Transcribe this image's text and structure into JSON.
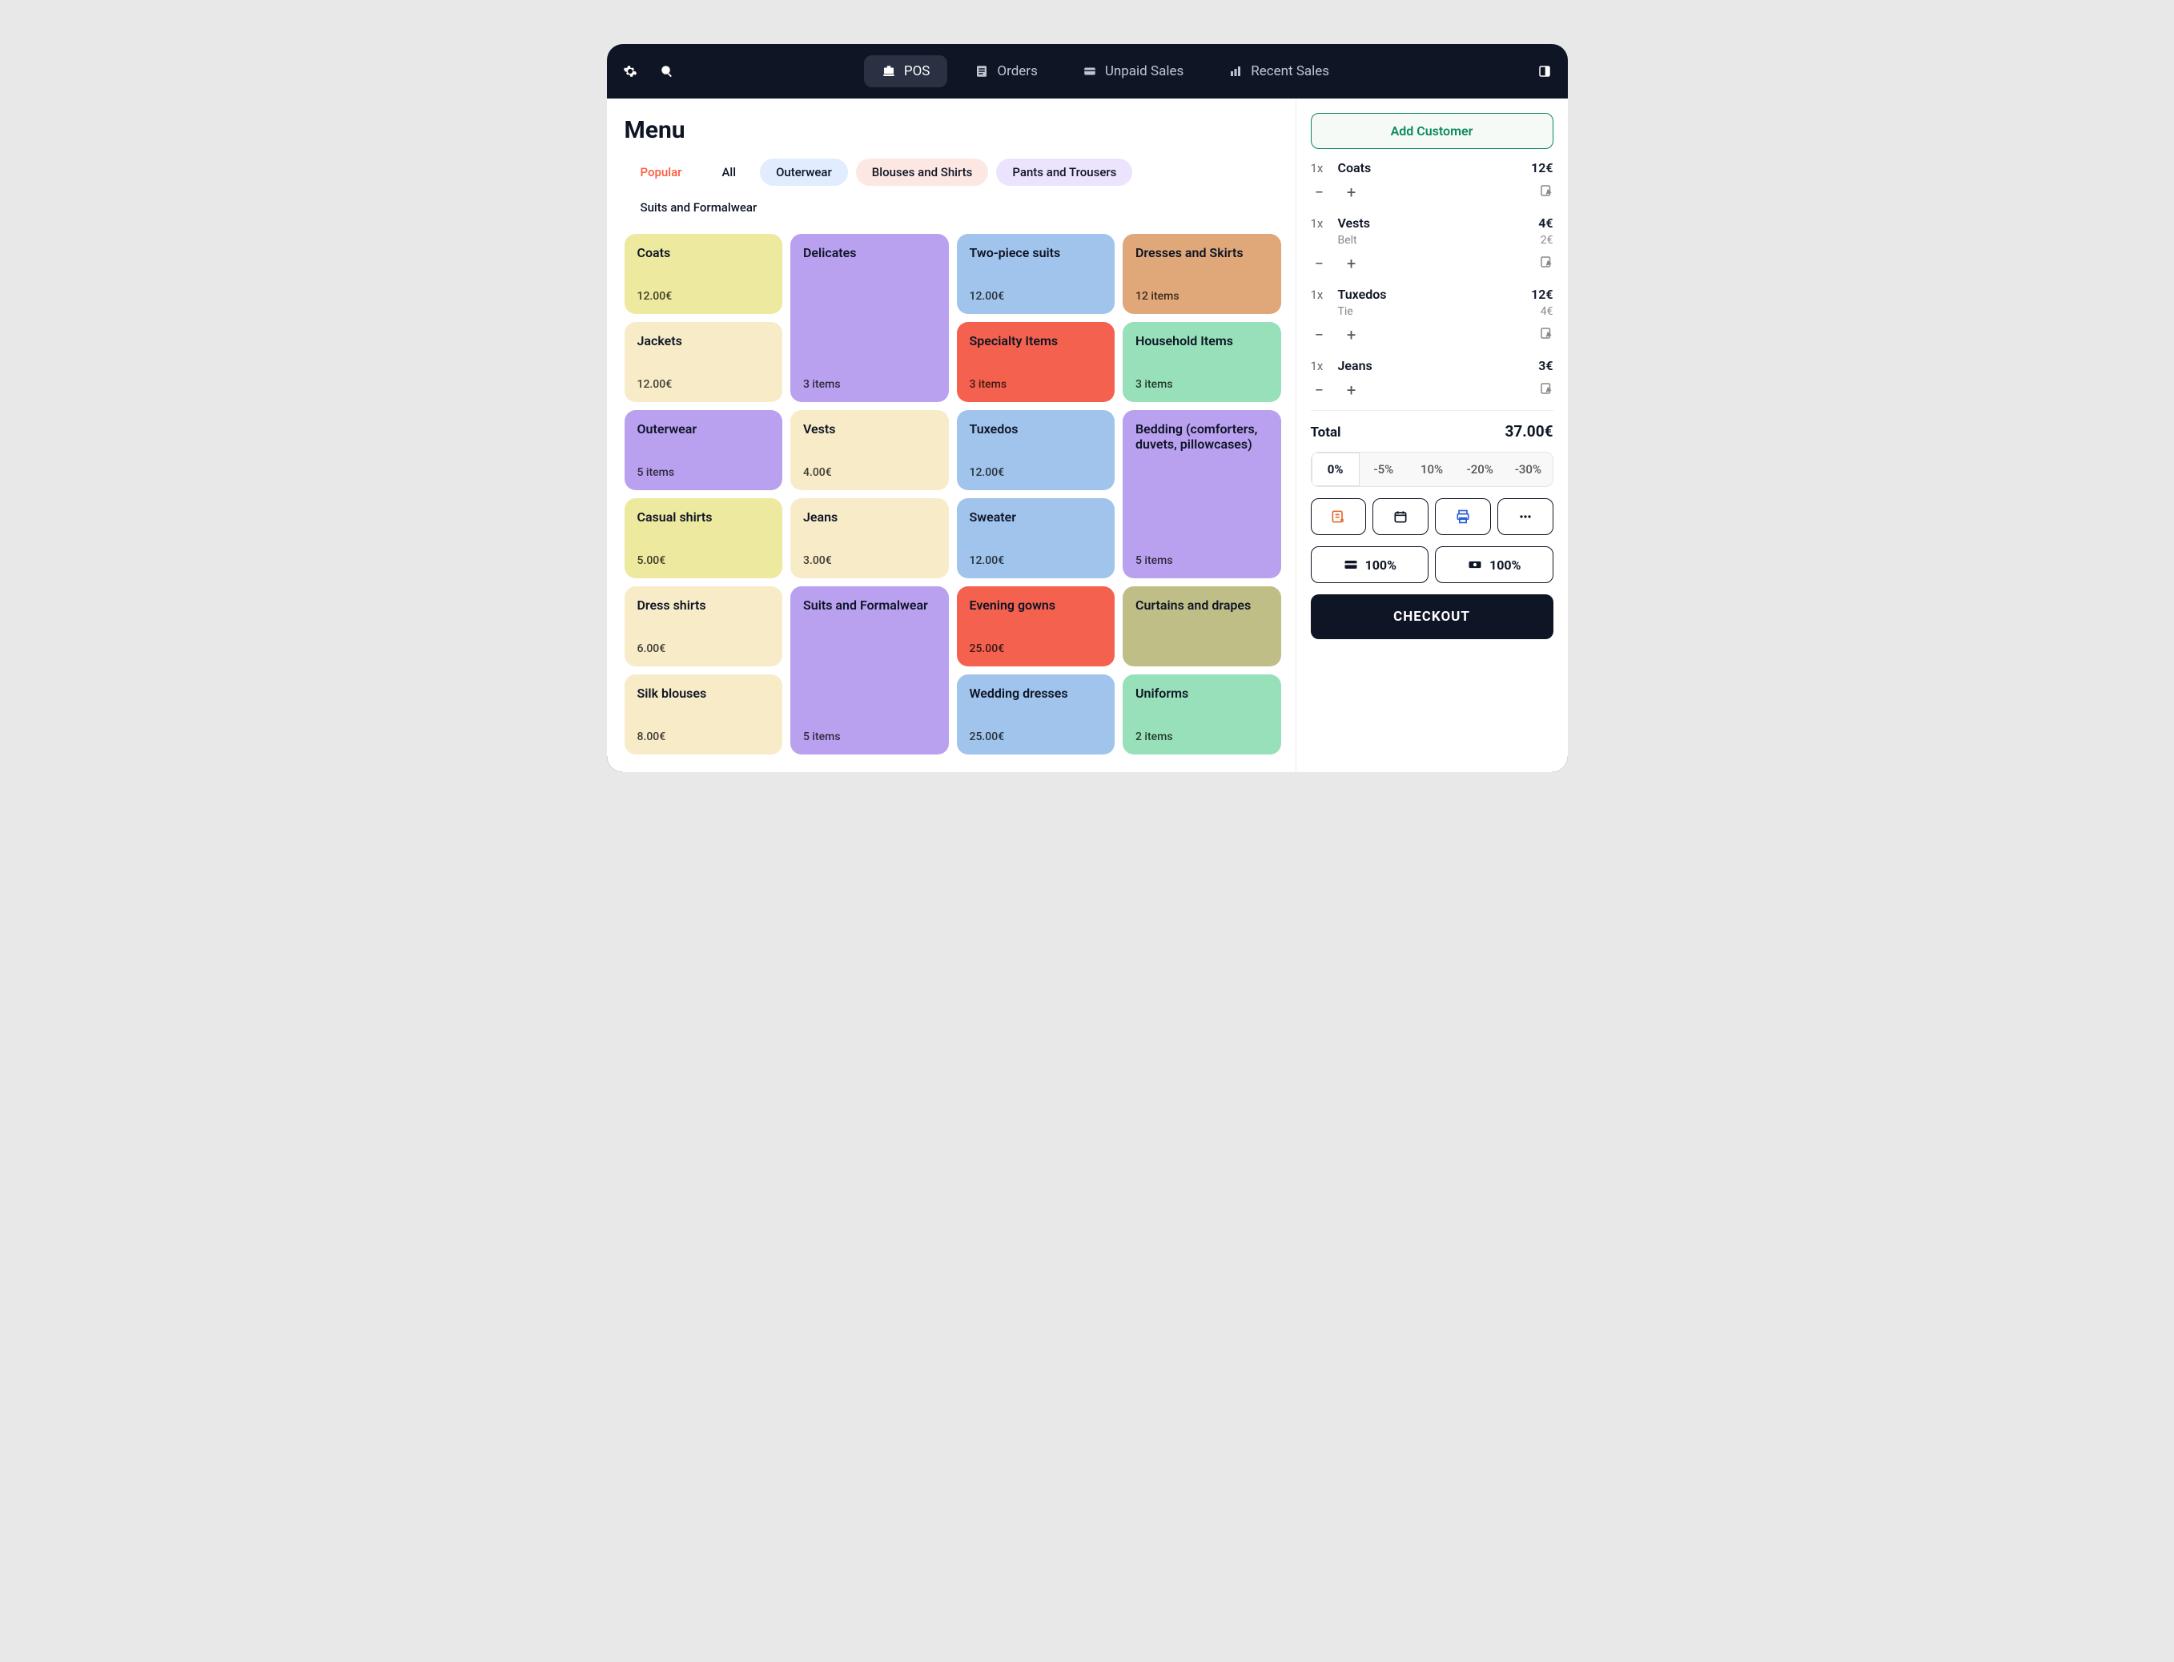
{
  "nav": {
    "pos": "POS",
    "orders": "Orders",
    "unpaid": "Unpaid Sales",
    "recent": "Recent Sales"
  },
  "menu": {
    "title": "Menu",
    "filters": [
      {
        "label": "Popular",
        "active": true,
        "bg": "",
        "color": "#ff5a3c"
      },
      {
        "label": "All",
        "active": false,
        "bg": "",
        "color": "#0e1525"
      },
      {
        "label": "Outerwear",
        "active": false,
        "bg": "#e1ecff",
        "color": "#0e1525"
      },
      {
        "label": "Blouses and Shirts",
        "active": false,
        "bg": "#fde7e2",
        "color": "#0e1525"
      },
      {
        "label": "Pants and Trousers",
        "active": false,
        "bg": "#ece4ff",
        "color": "#0e1525"
      },
      {
        "label": "Suits and Formalwear",
        "active": false,
        "bg": "",
        "color": "#0e1525"
      }
    ],
    "tiles": [
      {
        "title": "Coats",
        "meta": "12.00€",
        "colStart": 1,
        "rowStart": 1,
        "rowSpan": 1,
        "bg": "#ede99e"
      },
      {
        "title": "Delicates",
        "meta": "3 items",
        "colStart": 2,
        "rowStart": 1,
        "rowSpan": 2,
        "bg": "#b9a1f0"
      },
      {
        "title": "Two-piece suits",
        "meta": "12.00€",
        "colStart": 3,
        "rowStart": 1,
        "rowSpan": 1,
        "bg": "#a0c4ec"
      },
      {
        "title": "Dresses and Skirts",
        "meta": "12 items",
        "colStart": 4,
        "rowStart": 1,
        "rowSpan": 1,
        "bg": "#e0a778"
      },
      {
        "title": "Jackets",
        "meta": "12.00€",
        "colStart": 1,
        "rowStart": 2,
        "rowSpan": 1,
        "bg": "#f7ebc8"
      },
      {
        "title": "Specialty Items",
        "meta": "3 items",
        "colStart": 3,
        "rowStart": 2,
        "rowSpan": 1,
        "bg": "#f4614e"
      },
      {
        "title": "Household Items",
        "meta": "3 items",
        "colStart": 4,
        "rowStart": 2,
        "rowSpan": 1,
        "bg": "#97e0b9"
      },
      {
        "title": "Outerwear",
        "meta": "5 items",
        "colStart": 1,
        "rowStart": 3,
        "rowSpan": 1,
        "bg": "#b9a1f0"
      },
      {
        "title": "Vests",
        "meta": "4.00€",
        "colStart": 2,
        "rowStart": 3,
        "rowSpan": 1,
        "bg": "#f7ebc8"
      },
      {
        "title": "Tuxedos",
        "meta": "12.00€",
        "colStart": 3,
        "rowStart": 3,
        "rowSpan": 1,
        "bg": "#a0c4ec"
      },
      {
        "title": "Bedding (comforters, duvets, pillowcases)",
        "meta": "5 items",
        "colStart": 4,
        "rowStart": 3,
        "rowSpan": 2,
        "bg": "#b9a1f0"
      },
      {
        "title": "Casual shirts",
        "meta": "5.00€",
        "colStart": 1,
        "rowStart": 4,
        "rowSpan": 1,
        "bg": "#ede99e"
      },
      {
        "title": "Jeans",
        "meta": "3.00€",
        "colStart": 2,
        "rowStart": 4,
        "rowSpan": 1,
        "bg": "#f7ebc8"
      },
      {
        "title": "Sweater",
        "meta": "12.00€",
        "colStart": 3,
        "rowStart": 4,
        "rowSpan": 1,
        "bg": "#a0c4ec"
      },
      {
        "title": "Dress shirts",
        "meta": "6.00€",
        "colStart": 1,
        "rowStart": 5,
        "rowSpan": 1,
        "bg": "#f7ebc8"
      },
      {
        "title": "Suits and Formalwear",
        "meta": "5 items",
        "colStart": 2,
        "rowStart": 5,
        "rowSpan": 2,
        "bg": "#b9a1f0"
      },
      {
        "title": "Evening gowns",
        "meta": "25.00€",
        "colStart": 3,
        "rowStart": 5,
        "rowSpan": 1,
        "bg": "#f4614e"
      },
      {
        "title": "Curtains and drapes",
        "meta": "",
        "colStart": 4,
        "rowStart": 5,
        "rowSpan": 1,
        "bg": "#c0be87"
      },
      {
        "title": "Silk blouses",
        "meta": "8.00€",
        "colStart": 1,
        "rowStart": 6,
        "rowSpan": 1,
        "bg": "#f7ebc8"
      },
      {
        "title": "Wedding dresses",
        "meta": "25.00€",
        "colStart": 3,
        "rowStart": 6,
        "rowSpan": 1,
        "bg": "#a0c4ec"
      },
      {
        "title": "Uniforms",
        "meta": "2 items",
        "colStart": 4,
        "rowStart": 6,
        "rowSpan": 1,
        "bg": "#97e0b9"
      }
    ]
  },
  "cart": {
    "add_customer": "Add Customer",
    "items": [
      {
        "qty": "1x",
        "name": "Coats",
        "price": "12€",
        "subs": []
      },
      {
        "qty": "1x",
        "name": "Vests",
        "price": "4€",
        "subs": [
          {
            "name": "Belt",
            "price": "2€"
          }
        ]
      },
      {
        "qty": "1x",
        "name": "Tuxedos",
        "price": "12€",
        "subs": [
          {
            "name": "Tie",
            "price": "4€"
          }
        ]
      },
      {
        "qty": "1x",
        "name": "Jeans",
        "price": "3€",
        "subs": []
      }
    ],
    "total_label": "Total",
    "total_amount": "37.00€",
    "discounts": [
      "0%",
      "-5%",
      "10%",
      "-20%",
      "-30%"
    ],
    "discount_active": 0,
    "payment_card": "100%",
    "payment_cash": "100%",
    "checkout": "CHECKOUT"
  }
}
